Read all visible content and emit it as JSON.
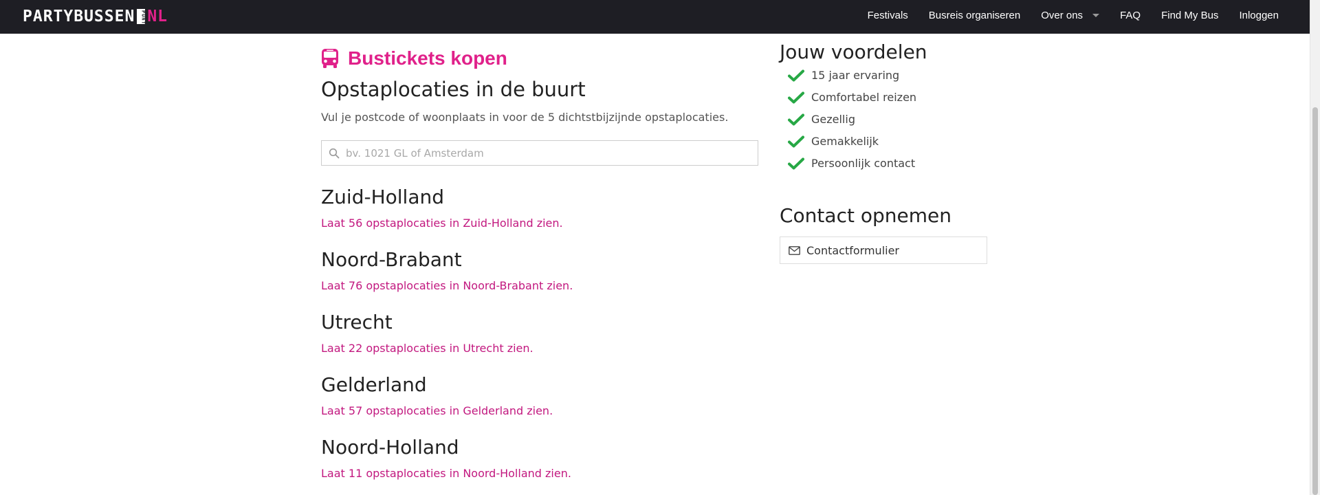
{
  "brand": {
    "logo_part1": "PARTYBUSSEN",
    "logo_mid": "PUNT",
    "logo_part2": "NL"
  },
  "nav": {
    "items": [
      "Festivals",
      "Busreis organiseren",
      "Over ons",
      "FAQ",
      "Find My Bus",
      "Inloggen"
    ]
  },
  "main": {
    "title": "Bustickets kopen",
    "subtitle": "Opstaplocaties in de buurt",
    "instruction": "Vul je postcode of woonplaats in voor de 5 dichtstbijzijnde opstaplocaties.",
    "search_placeholder": "bv. 1021 GL of Amsterdam",
    "provinces": [
      {
        "name": "Zuid-Holland",
        "link": "Laat 56 opstaplocaties in Zuid-Holland zien."
      },
      {
        "name": "Noord-Brabant",
        "link": "Laat 76 opstaplocaties in Noord-Brabant zien."
      },
      {
        "name": "Utrecht",
        "link": "Laat 22 opstaplocaties in Utrecht zien."
      },
      {
        "name": "Gelderland",
        "link": "Laat 57 opstaplocaties in Gelderland zien."
      },
      {
        "name": "Noord-Holland",
        "link": "Laat 11 opstaplocaties in Noord-Holland zien."
      }
    ]
  },
  "side": {
    "benefits_title": "Jouw voordelen",
    "benefits": [
      "15 jaar ervaring",
      "Comfortabel reizen",
      "Gezellig",
      "Gemakkelijk",
      "Persoonlijk contact"
    ],
    "contact_title": "Contact opnemen",
    "contact_form_label": "Contactformulier"
  },
  "colors": {
    "accent": "#e0218a",
    "check": "#27a845",
    "topbar": "#1e1e24"
  }
}
